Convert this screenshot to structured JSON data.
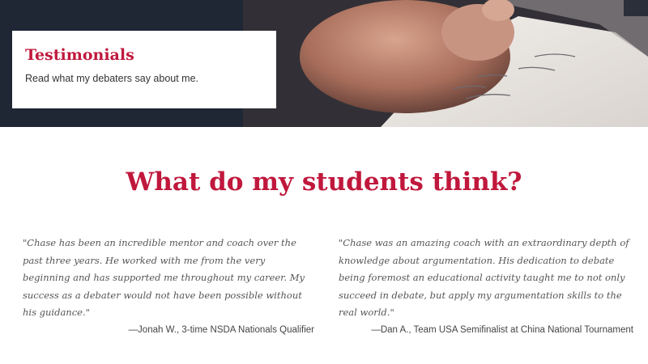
{
  "hero": {
    "title": "Testimonials",
    "subtitle": "Read what my debaters say about me."
  },
  "main": {
    "headline": "What do my students think?"
  },
  "testimonials": [
    {
      "quote": "\"Chase has been an incredible mentor and coach over the past three years. He worked with me from the very beginning and has supported me throughout my career. My success as a debater would not have been possible without his guidance.\"",
      "attribution": "—Jonah W., 3-time NSDA Nationals Qualifier"
    },
    {
      "quote": "\"Chase was an amazing coach with an extraordinary depth of knowledge about argumentation. His dedication to debate being foremost an educational activity taught me to not only succeed in debate, but apply my argumentation skills to the real world.\"",
      "attribution": "—Dan A., Team USA Semifinalist at China National Tournament"
    }
  ],
  "colors": {
    "accent": "#c0183c"
  }
}
